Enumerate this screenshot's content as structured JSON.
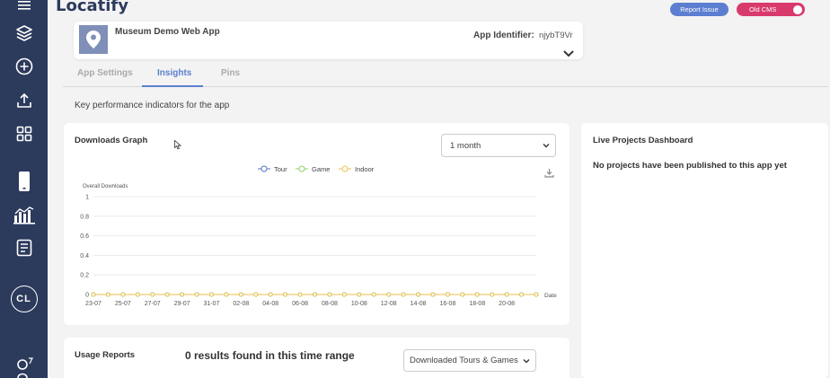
{
  "app_logo": "Locatify",
  "header": {
    "report_issue": "Report Issue",
    "old_cms": "Old CMS"
  },
  "sidebar": {
    "items": [
      {
        "icon": "menu-icon"
      },
      {
        "icon": "layers-icon"
      },
      {
        "icon": "add-circle-icon"
      },
      {
        "icon": "upload-icon"
      },
      {
        "icon": "apps-grid-icon"
      },
      {
        "icon": "mobile-device-icon"
      },
      {
        "icon": "insights-chart-icon"
      },
      {
        "icon": "report-list-icon"
      }
    ],
    "avatar_initials": "CL"
  },
  "app_card": {
    "name": "Museum Demo Web App",
    "identifier_label": "App Identifier:",
    "identifier_value": "njybT9Vr"
  },
  "tabs": [
    {
      "label": "App Settings",
      "active": false
    },
    {
      "label": "Insights",
      "active": true
    },
    {
      "label": "Pins",
      "active": false
    }
  ],
  "kpi_description": "Key performance indicators for the app",
  "downloads_card": {
    "title": "Downloads Graph",
    "range_select": "1 month"
  },
  "live_card": {
    "title": "Live Projects Dashboard",
    "message": "No projects have been published to this app yet"
  },
  "usage_card": {
    "title": "Usage Reports",
    "results": "0 results found in this time range",
    "filter_select": "Downloaded Tours & Games"
  },
  "colors": {
    "sidebar": "#2c3a5c",
    "accent": "#5b7ed0",
    "old_cms": "#d93a6c",
    "tour": "#5b6fc7",
    "game": "#8ccf6a",
    "indoor": "#e8c14a"
  },
  "chart_data": {
    "type": "line",
    "ylabel": "Overall Downloads",
    "xlabel": "Date",
    "ylim": [
      0,
      1
    ],
    "yticks": [
      "0",
      "0.2",
      "0.4",
      "0.6",
      "0.8",
      "1"
    ],
    "x": [
      "23-07",
      "24-07",
      "25-07",
      "26-07",
      "27-07",
      "28-07",
      "29-07",
      "30-07",
      "31-07",
      "01-08",
      "02-08",
      "03-08",
      "04-08",
      "05-08",
      "06-08",
      "07-08",
      "08-08",
      "09-08",
      "10-08",
      "11-08",
      "12-08",
      "13-08",
      "14-08",
      "15-08",
      "16-08",
      "17-08",
      "18-08",
      "19-08",
      "20-08",
      "21-08",
      "22-08"
    ],
    "xtick_labels": [
      "23-07",
      "25-07",
      "27-07",
      "29-07",
      "31-07",
      "02-08",
      "04-08",
      "06-08",
      "08-08",
      "10-08",
      "12-08",
      "14-08",
      "16-08",
      "18-08",
      "20-08"
    ],
    "series": [
      {
        "name": "Tour",
        "color": "#5b6fc7",
        "values": [
          0,
          0,
          0,
          0,
          0,
          0,
          0,
          0,
          0,
          0,
          0,
          0,
          0,
          0,
          0,
          0,
          0,
          0,
          0,
          0,
          0,
          0,
          0,
          0,
          0,
          0,
          0,
          0,
          0,
          0,
          0
        ]
      },
      {
        "name": "Game",
        "color": "#8ccf6a",
        "values": [
          0,
          0,
          0,
          0,
          0,
          0,
          0,
          0,
          0,
          0,
          0,
          0,
          0,
          0,
          0,
          0,
          0,
          0,
          0,
          0,
          0,
          0,
          0,
          0,
          0,
          0,
          0,
          0,
          0,
          0,
          0
        ]
      },
      {
        "name": "Indoor",
        "color": "#e8c14a",
        "values": [
          0,
          0,
          0,
          0,
          0,
          0,
          0,
          0,
          0,
          0,
          0,
          0,
          0,
          0,
          0,
          0,
          0,
          0,
          0,
          0,
          0,
          0,
          0,
          0,
          0,
          0,
          0,
          0,
          0,
          0,
          0
        ]
      }
    ],
    "legend": "top-center",
    "grid": true
  }
}
